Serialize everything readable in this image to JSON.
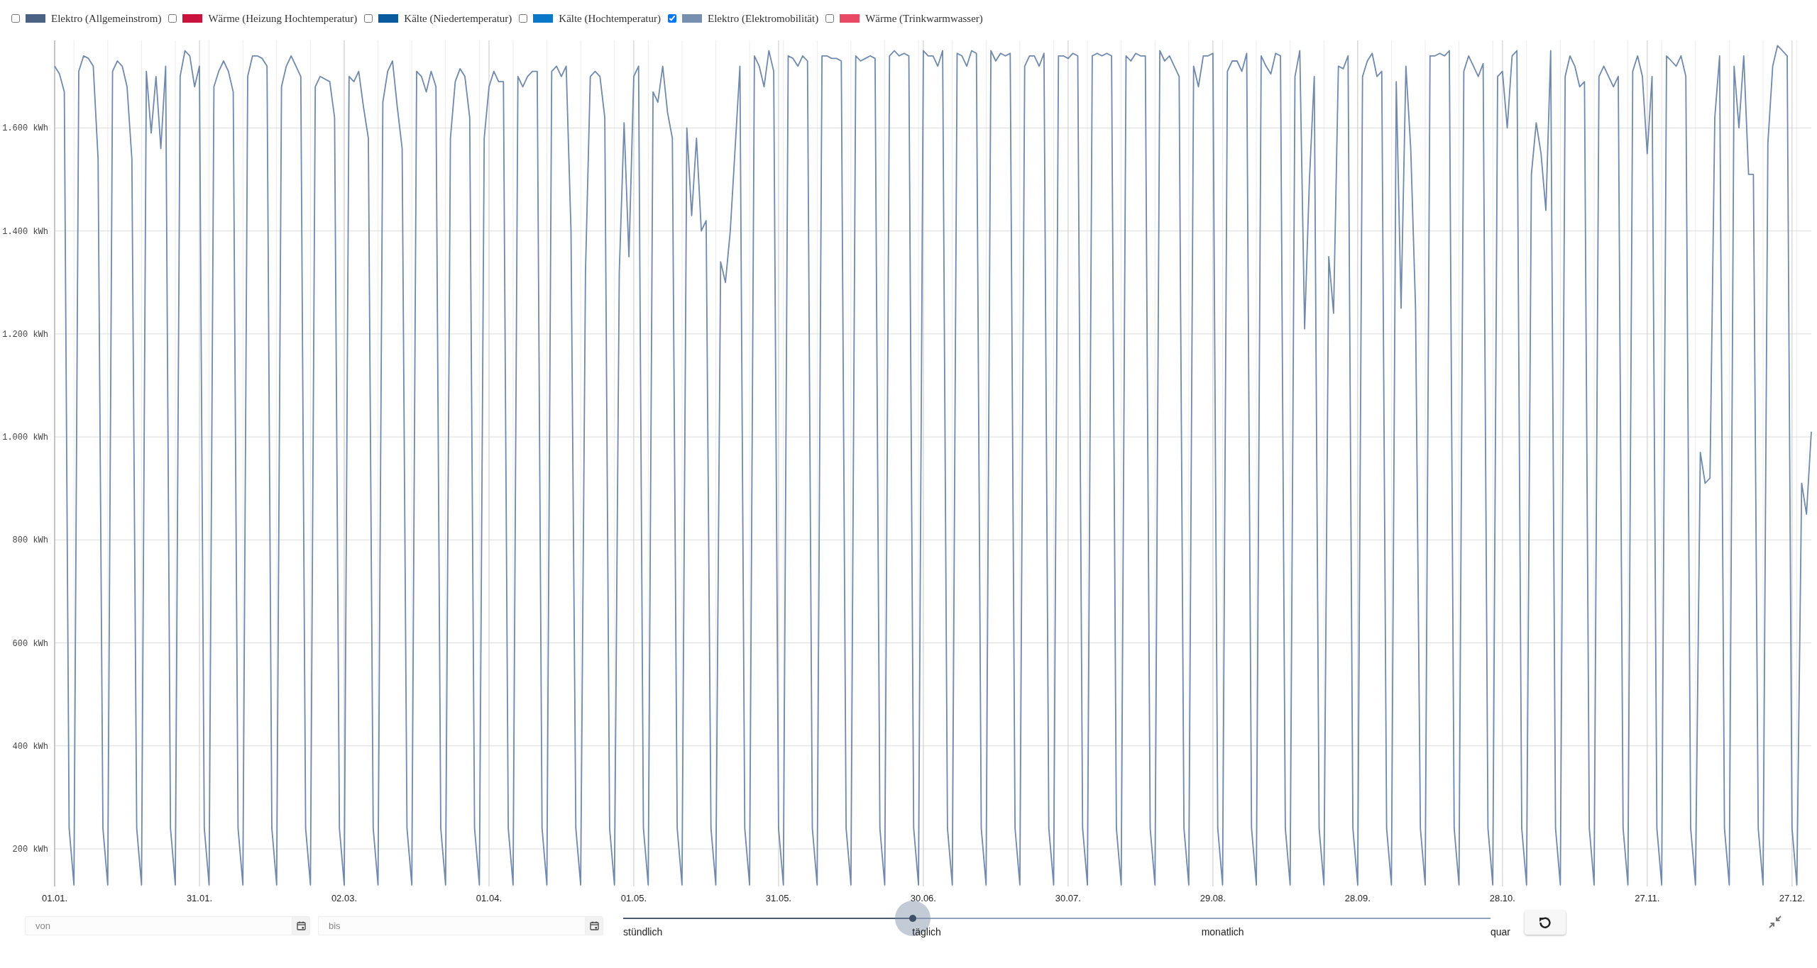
{
  "legend": [
    {
      "label": "Elektro (Allgemeinstrom)",
      "color": "#4a6283",
      "checked": false
    },
    {
      "label": "Wärme (Heizung Hochtemperatur)",
      "color": "#c8143c",
      "checked": false
    },
    {
      "label": "Kälte (Niedertemperatur)",
      "color": "#0a5aa0",
      "checked": false
    },
    {
      "label": "Kälte (Hochtemperatur)",
      "color": "#0a78c8",
      "checked": false
    },
    {
      "label": "Elektro (Elektromobilität)",
      "color": "#7890b0",
      "checked": true
    },
    {
      "label": "Wärme (Trinkwarmwasser)",
      "color": "#e84a64",
      "checked": false
    }
  ],
  "chart": {
    "chart_data": {
      "type": "line",
      "ylim": [
        127,
        1770
      ],
      "grid": true,
      "categories": [
        "01.01.",
        null,
        null,
        null,
        null,
        null,
        null,
        null,
        null,
        null,
        null,
        null,
        null,
        null,
        null,
        null,
        null,
        null,
        null,
        null,
        null,
        null,
        null,
        null,
        null,
        null,
        null,
        null,
        null,
        null,
        "31.01.",
        null,
        null,
        null,
        null,
        null,
        null,
        null,
        null,
        null,
        null,
        null,
        null,
        null,
        null,
        null,
        null,
        null,
        null,
        null,
        null,
        null,
        null,
        null,
        null,
        null,
        null,
        null,
        null,
        null,
        "02.03.",
        null,
        null,
        null,
        null,
        null,
        null,
        null,
        null,
        null,
        null,
        null,
        null,
        null,
        null,
        null,
        null,
        null,
        null,
        null,
        null,
        null,
        null,
        null,
        null,
        null,
        null,
        null,
        null,
        null,
        "01.04.",
        null,
        null,
        null,
        null,
        null,
        null,
        null,
        null,
        null,
        null,
        null,
        null,
        null,
        null,
        null,
        null,
        null,
        null,
        null,
        null,
        null,
        null,
        null,
        null,
        null,
        null,
        null,
        null,
        null,
        "01.05.",
        null,
        null,
        null,
        null,
        null,
        null,
        null,
        null,
        null,
        null,
        null,
        null,
        null,
        null,
        null,
        null,
        null,
        null,
        null,
        null,
        null,
        null,
        null,
        null,
        null,
        null,
        null,
        null,
        null,
        "31.05.",
        null,
        null,
        null,
        null,
        null,
        null,
        null,
        null,
        null,
        null,
        null,
        null,
        null,
        null,
        null,
        null,
        null,
        null,
        null,
        null,
        null,
        null,
        null,
        null,
        null,
        null,
        null,
        null,
        null,
        "30.06.",
        null,
        null,
        null,
        null,
        null,
        null,
        null,
        null,
        null,
        null,
        null,
        null,
        null,
        null,
        null,
        null,
        null,
        null,
        null,
        null,
        null,
        null,
        null,
        null,
        null,
        null,
        null,
        null,
        null,
        "30.07.",
        null,
        null,
        null,
        null,
        null,
        null,
        null,
        null,
        null,
        null,
        null,
        null,
        null,
        null,
        null,
        null,
        null,
        null,
        null,
        null,
        null,
        null,
        null,
        null,
        null,
        null,
        null,
        null,
        null,
        "29.08.",
        null,
        null,
        null,
        null,
        null,
        null,
        null,
        null,
        null,
        null,
        null,
        null,
        null,
        null,
        null,
        null,
        null,
        null,
        null,
        null,
        null,
        null,
        null,
        null,
        null,
        null,
        null,
        null,
        null,
        "28.09.",
        null,
        null,
        null,
        null,
        null,
        null,
        null,
        null,
        null,
        null,
        null,
        null,
        null,
        null,
        null,
        null,
        null,
        null,
        null,
        null,
        null,
        null,
        null,
        null,
        null,
        null,
        null,
        null,
        null,
        "28.10.",
        null,
        null,
        null,
        null,
        null,
        null,
        null,
        null,
        null,
        null,
        null,
        null,
        null,
        null,
        null,
        null,
        null,
        null,
        null,
        null,
        null,
        null,
        null,
        null,
        null,
        null,
        null,
        null,
        null,
        "27.11.",
        null,
        null,
        null,
        null,
        null,
        null,
        null,
        null,
        null,
        null,
        null,
        null,
        null,
        null,
        null,
        null,
        null,
        null,
        null,
        null,
        null,
        null,
        null,
        null,
        null,
        null,
        null,
        null,
        null,
        "27.12.",
        null,
        null,
        null,
        null
      ],
      "yticks": [
        {
          "value": 200,
          "label": "200 kWh"
        },
        {
          "value": 400,
          "label": "400 kWh"
        },
        {
          "value": 600,
          "label": "600 kWh"
        },
        {
          "value": 800,
          "label": "800 kWh"
        },
        {
          "value": 1000,
          "label": "1.000 kWh"
        },
        {
          "value": 1200,
          "label": "1.200 kWh"
        },
        {
          "value": 1400,
          "label": "1.400 kWh"
        },
        {
          "value": 1600,
          "label": "1.600 kWh"
        }
      ],
      "series": [
        {
          "color": "#7089ac",
          "values": [
            1720,
            1705,
            1670,
            240,
            130,
            1710,
            1740,
            1735,
            1720,
            1540,
            240,
            130,
            1710,
            1730,
            1720,
            1680,
            1540,
            240,
            130,
            1710,
            1590,
            1700,
            1560,
            1720,
            240,
            130,
            1700,
            1750,
            1740,
            1680,
            1720,
            240,
            130,
            1680,
            1710,
            1730,
            1710,
            1670,
            240,
            130,
            1700,
            1740,
            1740,
            1735,
            1720,
            240,
            130,
            1680,
            1720,
            1740,
            1720,
            1700,
            240,
            130,
            1680,
            1700,
            1695,
            1690,
            1620,
            240,
            130,
            1700,
            1690,
            1710,
            1640,
            1580,
            240,
            130,
            1650,
            1710,
            1730,
            1640,
            1560,
            240,
            130,
            1710,
            1700,
            1670,
            1710,
            1680,
            240,
            130,
            1580,
            1690,
            1715,
            1700,
            1620,
            240,
            130,
            1580,
            1680,
            1710,
            1690,
            1690,
            240,
            130,
            1700,
            1680,
            1700,
            1710,
            1710,
            240,
            130,
            1710,
            1720,
            1700,
            1720,
            1400,
            240,
            130,
            1320,
            1700,
            1710,
            1700,
            1620,
            240,
            130,
            1320,
            1610,
            1350,
            1700,
            1720,
            240,
            130,
            1670,
            1650,
            1720,
            1630,
            1580,
            240,
            130,
            1600,
            1430,
            1580,
            1400,
            1420,
            240,
            130,
            1340,
            1300,
            1400,
            1560,
            1720,
            240,
            130,
            1740,
            1720,
            1680,
            1750,
            1710,
            240,
            130,
            1740,
            1735,
            1720,
            1740,
            1730,
            240,
            130,
            1740,
            1740,
            1735,
            1735,
            1730,
            240,
            130,
            1740,
            1730,
            1735,
            1740,
            1735,
            240,
            130,
            1740,
            1750,
            1740,
            1745,
            1740,
            240,
            130,
            1750,
            1740,
            1740,
            1720,
            1750,
            240,
            130,
            1745,
            1740,
            1720,
            1750,
            1745,
            240,
            130,
            1750,
            1730,
            1745,
            1740,
            1745,
            240,
            130,
            1720,
            1740,
            1740,
            1720,
            1745,
            240,
            130,
            1740,
            1740,
            1735,
            1745,
            1740,
            240,
            130,
            1740,
            1745,
            1740,
            1745,
            1740,
            240,
            130,
            1740,
            1730,
            1745,
            1740,
            1740,
            240,
            130,
            1750,
            1730,
            1740,
            1720,
            1700,
            240,
            130,
            1720,
            1680,
            1740,
            1740,
            1745,
            240,
            130,
            1710,
            1730,
            1730,
            1710,
            1745,
            240,
            130,
            1740,
            1720,
            1705,
            1745,
            1740,
            240,
            130,
            1700,
            1750,
            1210,
            1500,
            1700,
            240,
            130,
            1350,
            1240,
            1720,
            1715,
            1740,
            240,
            130,
            1700,
            1730,
            1745,
            1700,
            1710,
            240,
            130,
            1690,
            1250,
            1720,
            1560,
            1250,
            240,
            130,
            1740,
            1740,
            1745,
            1740,
            1750,
            240,
            130,
            1710,
            1740,
            1720,
            1700,
            1725,
            240,
            130,
            1700,
            1710,
            1600,
            1740,
            1750,
            240,
            130,
            1510,
            1610,
            1550,
            1440,
            1750,
            240,
            130,
            1700,
            1740,
            1720,
            1680,
            1690,
            240,
            130,
            1700,
            1720,
            1700,
            1680,
            1700,
            240,
            130,
            1710,
            1740,
            1700,
            1550,
            1700,
            240,
            130,
            1740,
            1730,
            1720,
            1740,
            1700,
            240,
            130,
            970,
            910,
            920,
            1620,
            1740,
            240,
            130,
            1720,
            1600,
            1740,
            1510,
            1510,
            240,
            130,
            1570,
            1720,
            1760,
            1750,
            1740,
            240,
            130,
            910,
            850,
            1010
          ]
        }
      ]
    }
  },
  "date_range": {
    "from": {
      "placeholder": "von"
    },
    "to": {
      "placeholder": "bis"
    }
  },
  "resolution_slider": {
    "level": 0.334,
    "stops": [
      {
        "label": "stündlich"
      },
      {
        "label": "täglich"
      },
      {
        "label": "monatlich"
      },
      {
        "label": "quar"
      }
    ]
  }
}
